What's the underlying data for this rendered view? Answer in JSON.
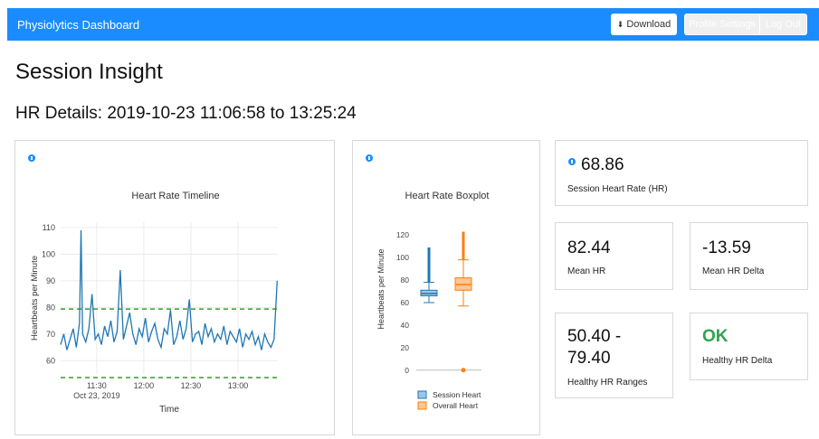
{
  "nav": {
    "brand": "Physiolytics Dashboard",
    "download_label": "Download",
    "download_icon": "download-icon",
    "profile_label": "Profile Settings",
    "logout_label": "Log Out"
  },
  "page": {
    "title": "Session Insight",
    "subtitle": "HR Details: 2019-10-23 11:06:58 to 13:25:24"
  },
  "colors": {
    "accent": "#1a8cff",
    "series_session": "#1f77b4",
    "series_overall": "#ff7f0e",
    "threshold": "#2ca02c",
    "ok": "#2ea44f"
  },
  "chart_data": [
    {
      "type": "line",
      "title": "Heart Rate Timeline",
      "xlabel": "Time",
      "ylabel": "Heartbeats per Minute",
      "x_ticks": [
        "11:30",
        "12:00",
        "12:30",
        "13:00"
      ],
      "x_tick_sub": "Oct 23, 2019",
      "x_range": [
        "11:06:58",
        "13:25:24"
      ],
      "ylim": [
        55,
        112
      ],
      "y_ticks": [
        60,
        70,
        80,
        90,
        100,
        110
      ],
      "grid": true,
      "threshold_lines": [
        79.4,
        50.4
      ],
      "series": [
        {
          "x_minutes_sampled": [
            0,
            2,
            4,
            6,
            8,
            10,
            12,
            13,
            14,
            16,
            18,
            20,
            22,
            24,
            26,
            28,
            30,
            32,
            34,
            36,
            38,
            40,
            42,
            44,
            46,
            48,
            50,
            52,
            54,
            56,
            58,
            60,
            62,
            64,
            66,
            68,
            70,
            72,
            74,
            76,
            78,
            80,
            82,
            84,
            86,
            88,
            90,
            92,
            94,
            96,
            98,
            100,
            102,
            104,
            106,
            108,
            110,
            112,
            114,
            116,
            118,
            120,
            122,
            124,
            126,
            128,
            130,
            132,
            134,
            136,
            138
          ],
          "values": [
            66,
            70,
            64,
            68,
            72,
            65,
            74,
            109,
            70,
            67,
            72,
            85,
            68,
            70,
            66,
            73,
            69,
            75,
            67,
            71,
            94,
            68,
            73,
            78,
            70,
            66,
            72,
            69,
            76,
            67,
            71,
            74,
            68,
            65,
            72,
            70,
            79,
            66,
            69,
            75,
            68,
            72,
            83,
            67,
            70,
            71,
            66,
            74,
            69,
            72,
            67,
            70,
            68,
            73,
            66,
            71,
            69,
            67,
            72,
            65,
            70,
            68,
            71,
            66,
            69,
            64,
            70,
            67,
            65,
            68,
            90
          ]
        }
      ]
    },
    {
      "type": "box",
      "title": "Heart Rate Boxplot",
      "ylabel": "Heartbeats per Minute",
      "ylim": [
        -5,
        125
      ],
      "y_ticks": [
        0,
        20,
        40,
        60,
        80,
        100,
        120
      ],
      "legend_position": "bottom",
      "series": [
        {
          "name": "Session Heart",
          "min": 60,
          "q1": 66,
          "median": 68,
          "q3": 71,
          "max": 78,
          "outlier_max": 109
        },
        {
          "name": "Overall Heart",
          "min": 57,
          "q1": 71,
          "median": 76,
          "q3": 82,
          "max": 98,
          "outlier_max": 123,
          "outlier_low": 0
        }
      ]
    }
  ],
  "stats": {
    "session_hr_value": "68.86",
    "session_hr_label": "Session Heart Rate (HR)",
    "mean_hr_value": "82.44",
    "mean_hr_label": "Mean HR",
    "mean_hr_delta_value": "-13.59",
    "mean_hr_delta_label": "Mean HR Delta",
    "healthy_ranges_value_line1": "50.40 -",
    "healthy_ranges_value_line2": "79.40",
    "healthy_ranges_label": "Healthy HR Ranges",
    "healthy_delta_value": "OK",
    "healthy_delta_label": "Healthy HR Delta"
  }
}
